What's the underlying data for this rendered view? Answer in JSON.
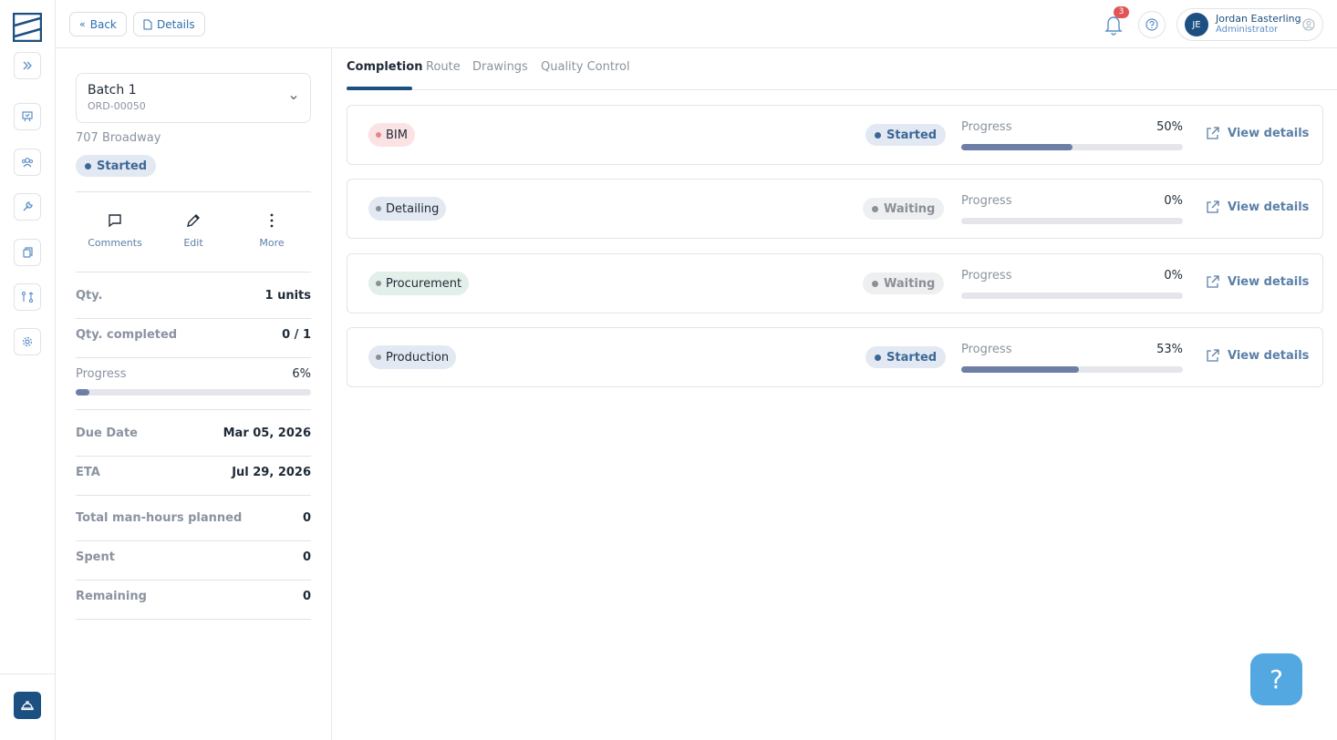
{
  "colors": {
    "brand": "#1c4f82",
    "started_bg": "#e2e9f2",
    "started_text": "#3e6796",
    "waiting_bg": "#eeeff1",
    "waiting_text": "#8b8f96",
    "bim_chip": "#fbe3e4",
    "detailing_chip": "#e2e9f2",
    "procurement_chip": "#e3efe9",
    "production_chip": "#e2e9f2",
    "progress_fill": "#6d7fa6",
    "fab": "#53a8e2"
  },
  "rail": {
    "icons": [
      "logo-icon",
      "expand-icon",
      "board-icon",
      "team-icon",
      "wrench-icon",
      "copy-icon",
      "route-icon",
      "settings-icon",
      "hard-hat-icon"
    ]
  },
  "topbar": {
    "back_label": "Back",
    "details_label": "Details",
    "notifications_count": "3",
    "user_initials": "JE",
    "user_name": "Jordan Easterling",
    "user_role": "Administrator"
  },
  "left_panel": {
    "batch_title": "Batch 1",
    "batch_order": "ORD-00050",
    "address": "707 Broadway",
    "status": "Started",
    "actions": {
      "comments": "Comments",
      "edit": "Edit",
      "more": "More"
    },
    "qty_label": "Qty.",
    "qty_value": "1 units",
    "qty_completed_label": "Qty. completed",
    "qty_completed_value": "0 / 1",
    "progress_label": "Progress",
    "progress_value": "6%",
    "progress_fraction": 0.06,
    "due_label": "Due Date",
    "due_value": "Mar 05, 2026",
    "eta_label": "ETA",
    "eta_value": "Jul 29, 2026",
    "planned_label": "Total man-hours planned",
    "planned_value": "0",
    "spent_label": "Spent",
    "spent_value": "0",
    "remaining_label": "Remaining",
    "remaining_value": "0"
  },
  "tabs": [
    "Completion",
    "Route",
    "Drawings",
    "Quality Control"
  ],
  "stages": [
    {
      "name": "BIM",
      "status": "Started",
      "progress_label": "Progress",
      "progress_pct": "50%",
      "progress_fraction": 0.5,
      "link": "View details"
    },
    {
      "name": "Detailing",
      "status": "Waiting",
      "progress_label": "Progress",
      "progress_pct": "0%",
      "progress_fraction": 0.0,
      "link": "View details"
    },
    {
      "name": "Procurement",
      "status": "Waiting",
      "progress_label": "Progress",
      "progress_pct": "0%",
      "progress_fraction": 0.0,
      "link": "View details"
    },
    {
      "name": "Production",
      "status": "Started",
      "progress_label": "Progress",
      "progress_pct": "53%",
      "progress_fraction": 0.53,
      "link": "View details"
    }
  ],
  "fab_label": "?"
}
